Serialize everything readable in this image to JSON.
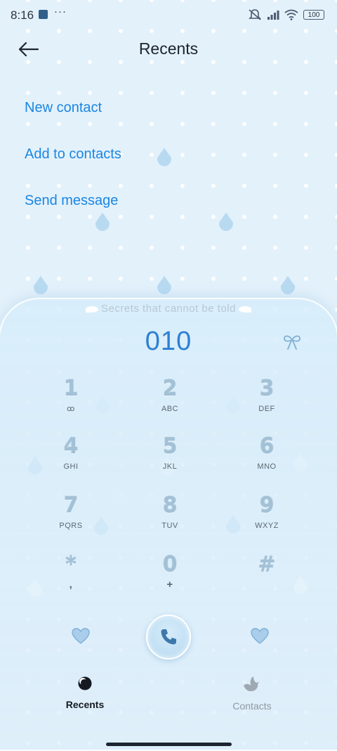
{
  "status_bar": {
    "time": "8:16",
    "dots": "···",
    "battery": "100"
  },
  "header": {
    "title": "Recents"
  },
  "menu": {
    "items": [
      {
        "label": "New contact"
      },
      {
        "label": "Add to contacts"
      },
      {
        "label": "Send message"
      }
    ]
  },
  "dialer": {
    "slogan": "Secrets that cannot be told",
    "number": "010",
    "keys": [
      {
        "digit": "1",
        "letters": "ꝏ"
      },
      {
        "digit": "2",
        "letters": "ABC"
      },
      {
        "digit": "3",
        "letters": "DEF"
      },
      {
        "digit": "4",
        "letters": "GHI"
      },
      {
        "digit": "5",
        "letters": "JKL"
      },
      {
        "digit": "6",
        "letters": "MNO"
      },
      {
        "digit": "7",
        "letters": "PQRS"
      },
      {
        "digit": "8",
        "letters": "TUV"
      },
      {
        "digit": "9",
        "letters": "WXYZ"
      },
      {
        "digit": "*",
        "letters": ","
      },
      {
        "digit": "0",
        "letters": "+"
      },
      {
        "digit": "#",
        "letters": ""
      }
    ]
  },
  "tabs": [
    {
      "label": "Recents",
      "icon": "moon-icon",
      "active": true
    },
    {
      "label": "Contacts",
      "icon": "bird-icon",
      "active": false
    }
  ],
  "colors": {
    "background": "#e3f1fb",
    "accent": "#1a86e2",
    "number": "#2d7fd3",
    "digit": "#a3c1d6"
  }
}
